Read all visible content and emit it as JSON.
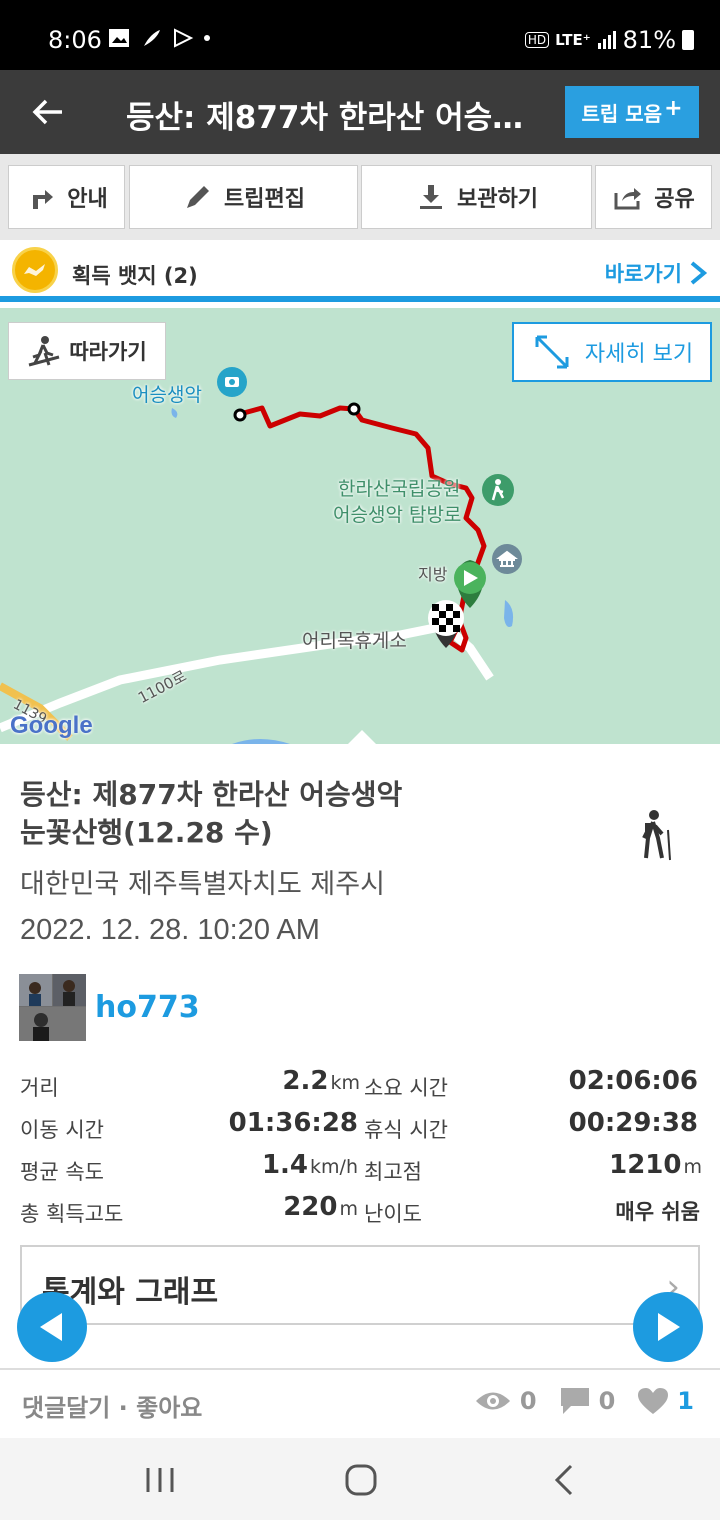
{
  "status_bar": {
    "time": "8:06",
    "network": "LTE⁺",
    "battery": "81%",
    "hd": "HD"
  },
  "header": {
    "title": "등산: 제877차 한라산 어승…",
    "trip_collection": "트립 모음"
  },
  "toolbar": {
    "guide": "안내",
    "edit": "트립편집",
    "save": "보관하기",
    "share": "공유"
  },
  "badge": {
    "label": "획득 뱃지 (2)",
    "goto": "바로가기"
  },
  "map": {
    "follow": "따라가기",
    "detail": "자세히 보기",
    "labels": {
      "peak": "어승생악",
      "park_line1": "한라산국립공원",
      "park_line2": "어승생악 탐방로",
      "office": "지방",
      "rest_area": "어리목휴게소",
      "road": "1100로",
      "road_num": "1139",
      "google": "Google"
    }
  },
  "trip": {
    "title_line1": "등산: 제877차 한라산 어승생악",
    "title_line2": "눈꽃산행(12.28 수)",
    "location": "대한민국 제주특별자치도 제주시",
    "date": "2022. 12. 28. 10:20 AM",
    "user": "ho773"
  },
  "stats": {
    "distance_label": "거리",
    "distance_value": "2.2",
    "distance_unit": "km",
    "duration_label": "소요 시간",
    "duration_value": "02:06:06",
    "moving_label": "이동 시간",
    "moving_value": "01:36:28",
    "rest_label": "휴식 시간",
    "rest_value": "00:29:38",
    "speed_label": "평균 속도",
    "speed_value": "1.4",
    "speed_unit": "km/h",
    "max_label": "최고점",
    "max_value": "1210",
    "max_unit": "m",
    "gain_label": "총 획득고도",
    "gain_value": "220",
    "gain_unit": "m",
    "difficulty_label": "난이도",
    "difficulty_value": "매우 쉬움"
  },
  "stats_graph": "통계와 그래프",
  "footer": {
    "comment_like": "댓글달기 · 좋아요",
    "views": "0",
    "comments": "0",
    "likes": "1"
  },
  "colors": {
    "accent": "#1d9be0",
    "header": "#3b3b3b",
    "route": "#cc0000",
    "map_bg": "#bfe3cf"
  }
}
